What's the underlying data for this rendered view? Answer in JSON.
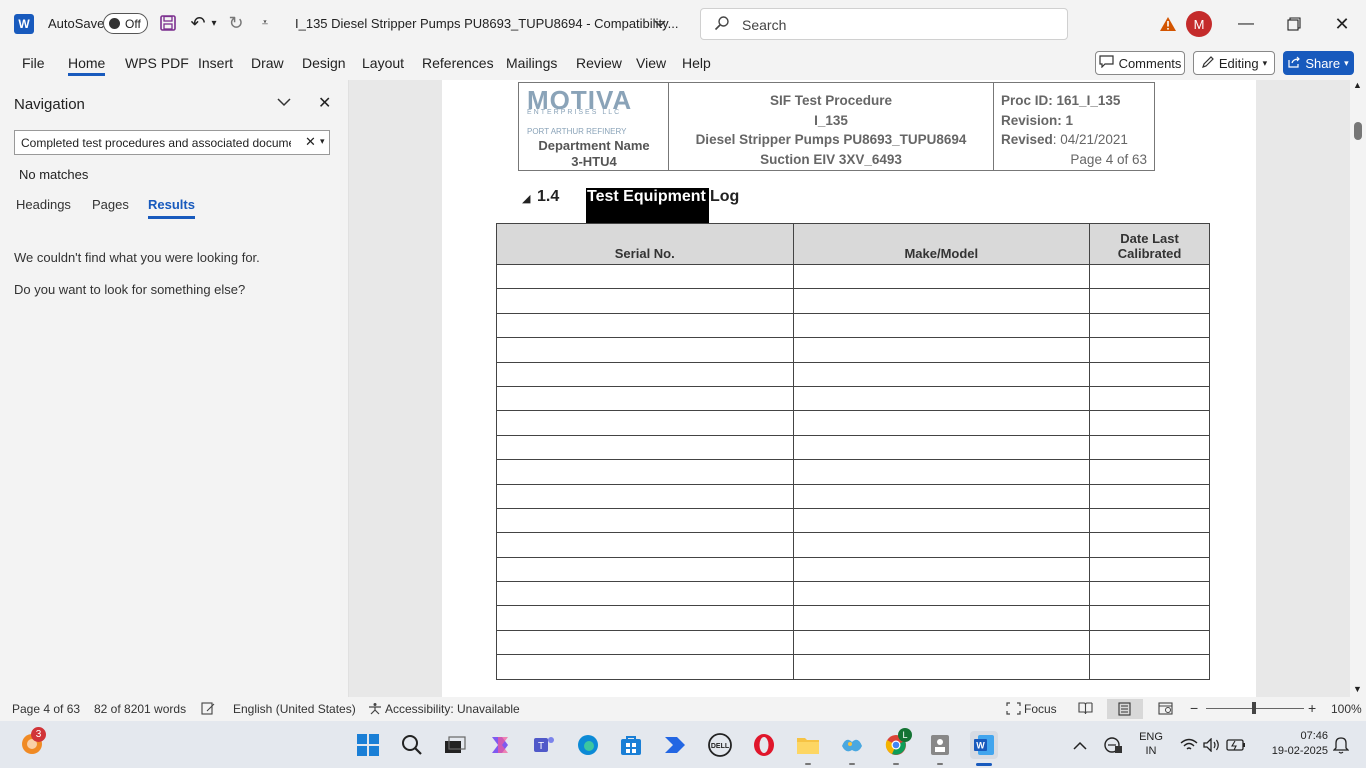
{
  "titlebar": {
    "app_icon": "W",
    "autosave_label": "AutoSave",
    "autosave_state": "Off",
    "doc_title": "I_135 Diesel Stripper Pumps PU8693_TUPU8694  -  Compatibility...",
    "search_placeholder": "Search",
    "avatar_initial": "M"
  },
  "ribbon": {
    "tabs": [
      "File",
      "Home",
      "WPS PDF",
      "Insert",
      "Draw",
      "Design",
      "Layout",
      "References",
      "Mailings",
      "Review",
      "View",
      "Help"
    ],
    "active_tab": "Home",
    "comments_label": "Comments",
    "editing_label": "Editing",
    "share_label": "Share"
  },
  "navigation": {
    "title": "Navigation",
    "search_value": "Completed test procedures and associated documents",
    "no_matches": "No matches",
    "tabs": [
      "Headings",
      "Pages",
      "Results"
    ],
    "active_tab": "Results",
    "message1": "We couldn't find what you were looking for.",
    "message2": "Do you want to look for something else?"
  },
  "document": {
    "header": {
      "logo_text": "MOTIVA",
      "logo_sub": "ENTERPRISES LLC",
      "refinery": "PORT ARTHUR REFINERY",
      "dept_line1": "Department Name",
      "dept_line2": "3-HTU4",
      "center_line1": "SIF Test Procedure",
      "center_line2": "I_135",
      "center_line3": "Diesel Stripper Pumps PU8693_TUPU8694",
      "center_line4": "Suction EIV 3XV_6493",
      "proc_id_label": "Proc ID:",
      "proc_id_value": "161_I_135",
      "revision_label": "Revision:",
      "revision_value": "1",
      "revised_label": "Revised",
      "revised_value": ": 04/21/2021",
      "page_of": "Page 4 of 63"
    },
    "section": {
      "number": "1.4",
      "title_highlight": "Test Equipment",
      "title_rest": " Log"
    },
    "table": {
      "columns": [
        "Serial No.",
        "Make/Model",
        "Date Last Calibrated"
      ],
      "empty_rows": 17
    }
  },
  "statusbar": {
    "page": "Page 4 of 63",
    "words": "82 of 8201 words",
    "language": "English (United States)",
    "accessibility": "Accessibility: Unavailable",
    "focus": "Focus",
    "zoom": "100%"
  },
  "taskbar": {
    "notification_count": "3",
    "teams_badge": "L",
    "lang_line1": "ENG",
    "lang_line2": "IN",
    "time": "07:46",
    "date": "19-02-2025"
  },
  "colors": {
    "accent": "#185abd",
    "avatar": "#c42b2b",
    "warning": "#d35400",
    "logo": "#8aa3b8"
  }
}
